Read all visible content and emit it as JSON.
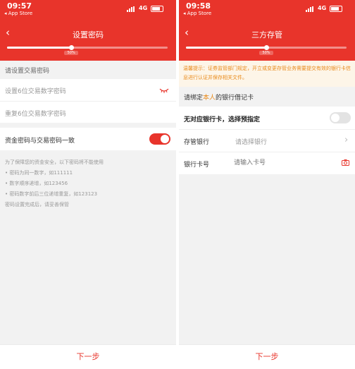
{
  "left": {
    "status": {
      "time": "09:57",
      "store": "◂ App Store",
      "net": "4G"
    },
    "title": "设置密码",
    "progress_pct": 40,
    "progress_label": "50%",
    "section": "请设置交易密码",
    "fields": {
      "trade_pwd": "设置6位交易数字密码",
      "confirm_pwd": "重复6位交易数字密码"
    },
    "toggle_label": "资金密码与交易密码一致",
    "toggle_on": true,
    "tips": [
      "为了保障您的资金安全，以下密码将不能使用",
      "• 密码为同一数字，如111111",
      "• 数字顺序递增，如123456",
      "• 密码数字前后三位递增重复，如123123",
      "密码设置完成后，请妥善保管"
    ],
    "next": "下一步"
  },
  "right": {
    "status": {
      "time": "09:58",
      "store": "◂ App Store",
      "net": "4G"
    },
    "title": "三方存管",
    "progress_pct": 50,
    "progress_label": "50%",
    "notice": "温馨提示：证券监管部门规定，开立或变更存管业务需要提交有效的银行卡信息进行认证并保存相关文件。",
    "section_pre": "请绑定",
    "section_em": "本人",
    "section_post": "的银行借记卡",
    "no_card_label": "无对应银行卡，选择预指定",
    "toggle_on": false,
    "bank": {
      "label": "存管银行",
      "placeholder": "请选择银行"
    },
    "card": {
      "label": "银行卡号",
      "placeholder": "请输入卡号"
    },
    "next": "下一步"
  },
  "colors": {
    "accent": "#e8342b",
    "notice_text": "#e98a1a",
    "notice_bg": "#fdf5e8"
  },
  "icons": [
    "back-arrow-icon",
    "eye-closed-icon",
    "chevron-right-icon",
    "camera-icon"
  ]
}
